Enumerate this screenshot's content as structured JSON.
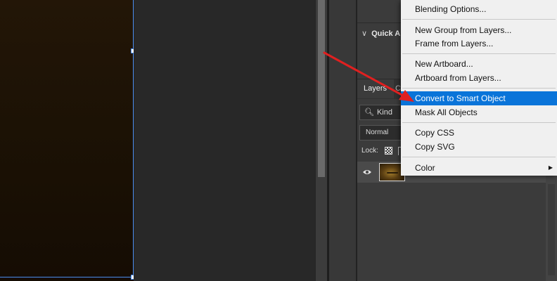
{
  "canvas": {
    "image_colors": [
      "#231607",
      "#150c03"
    ],
    "bounding_box_color": "#4a8cf0"
  },
  "properties_panel": {
    "quick_actions_label": "Quick A"
  },
  "layers_panel": {
    "tab_active": "Layers",
    "tab_next_partial": "C",
    "filter_label": "Kind",
    "filter_icon": "search-icon",
    "blend_mode": "Normal",
    "lock_label": "Lock:",
    "layer": {
      "visibility_icon": "eye-icon",
      "visible": true
    }
  },
  "context_menu": {
    "items": [
      {
        "label": "Blending Options..."
      },
      {
        "label": "New Group from Layers..."
      },
      {
        "label": "Frame from Layers..."
      },
      {
        "label": "New Artboard..."
      },
      {
        "label": "Artboard from Layers..."
      },
      {
        "label": "Convert to Smart Object",
        "highlighted": true
      },
      {
        "label": "Mask All Objects"
      },
      {
        "label": "Copy CSS"
      },
      {
        "label": "Copy SVG"
      },
      {
        "label": "Color",
        "has_submenu": true,
        "submenu_icon": "triangle-right-icon"
      }
    ],
    "highlight_color": "#0a74d9"
  },
  "annotation": {
    "arrow_color": "#e02020",
    "points_to": "Convert to Smart Object"
  }
}
